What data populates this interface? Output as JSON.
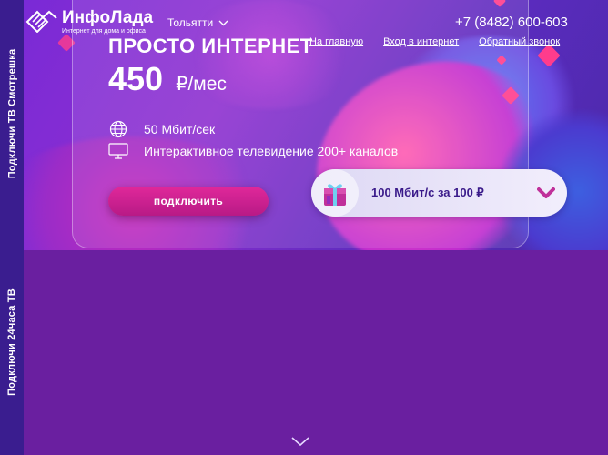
{
  "side_tabs": [
    {
      "label": "Подключи ТВ Смотрешка"
    },
    {
      "label": "Подключи 24часа ТВ"
    }
  ],
  "header": {
    "logo_name": "ИнфоЛада",
    "logo_tagline": "Интернет для дома и офиса",
    "city": "Тольятти",
    "phone": "+7 (8482) 600-603",
    "nav": [
      {
        "label": "На главную"
      },
      {
        "label": "Вход в интернет"
      },
      {
        "label": "Обратный звонок"
      }
    ]
  },
  "tariff": {
    "title": "ПРОСТО ИНТЕРНЕТ",
    "price": "450",
    "price_unit": "₽/мес",
    "features": [
      {
        "icon": "globe-icon",
        "text": "50 Мбит/сек"
      },
      {
        "icon": "tv-icon",
        "text": "Интерактивное телевидение 200+ каналов"
      }
    ],
    "connect_label": "подключить"
  },
  "promo": {
    "label": "100 Мбит/с за 100 ₽",
    "icon": "gift-icon"
  },
  "colors": {
    "page_bg": "#6a1fa0",
    "side_bar": "#3a1d8f",
    "button": "#d0228f",
    "promo_text": "#3a1a8a",
    "accent_pink": "#ff3c8c"
  }
}
